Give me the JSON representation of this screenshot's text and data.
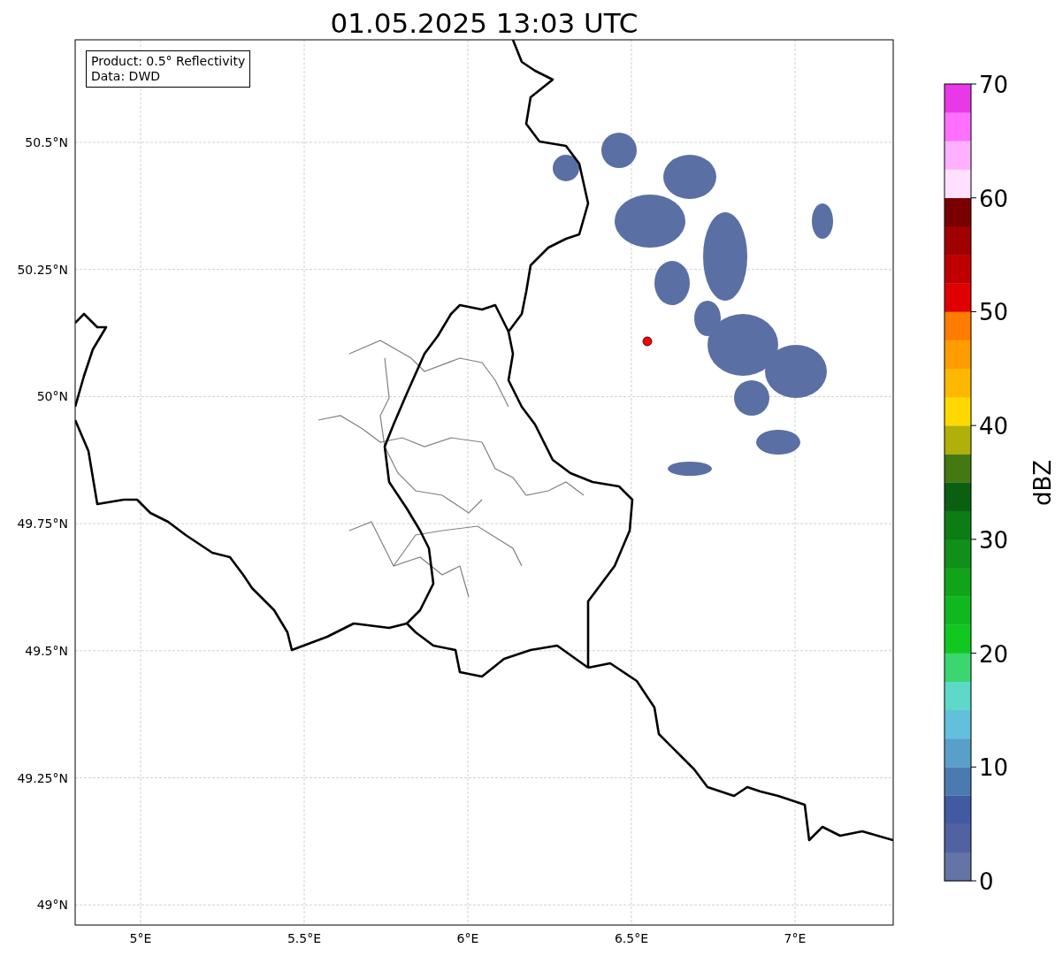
{
  "title": "01.05.2025 13:03 UTC",
  "legend": {
    "lines": [
      "Product: 0.5° Reflectivity",
      "Data: DWD"
    ]
  },
  "map": {
    "x_ticks": [
      "5°E",
      "5.5°E",
      "6°E",
      "6.5°E",
      "7°E"
    ],
    "y_ticks": [
      "50.5°N",
      "50.25°N",
      "50°N",
      "49.75°N",
      "49.5°N",
      "49.25°N",
      "49°N"
    ]
  },
  "colorbar": {
    "label": "dBZ",
    "ticks": [
      "70",
      "60",
      "50",
      "40",
      "30",
      "20",
      "10",
      "0"
    ],
    "segments": [
      {
        "color": "#6474a6"
      },
      {
        "color": "#5062a0"
      },
      {
        "color": "#425aa2"
      },
      {
        "color": "#4a7bb0"
      },
      {
        "color": "#58a0c8"
      },
      {
        "color": "#62c0dc"
      },
      {
        "color": "#5ed8c8"
      },
      {
        "color": "#3cd670"
      },
      {
        "color": "#10c820"
      },
      {
        "color": "#10b820"
      },
      {
        "color": "#10a418"
      },
      {
        "color": "#109018"
      },
      {
        "color": "#0c7c14"
      },
      {
        "color": "#0a6010"
      },
      {
        "color": "#447810"
      },
      {
        "color": "#b0b008"
      },
      {
        "color": "#ffd800"
      },
      {
        "color": "#ffb800"
      },
      {
        "color": "#ff9c00"
      },
      {
        "color": "#ff7c00"
      },
      {
        "color": "#e00000"
      },
      {
        "color": "#c00000"
      },
      {
        "color": "#a00000"
      },
      {
        "color": "#780000"
      },
      {
        "color": "#ffe0ff"
      },
      {
        "color": "#ffb0ff"
      },
      {
        "color": "#ff70ff"
      },
      {
        "color": "#e838e8"
      }
    ]
  }
}
